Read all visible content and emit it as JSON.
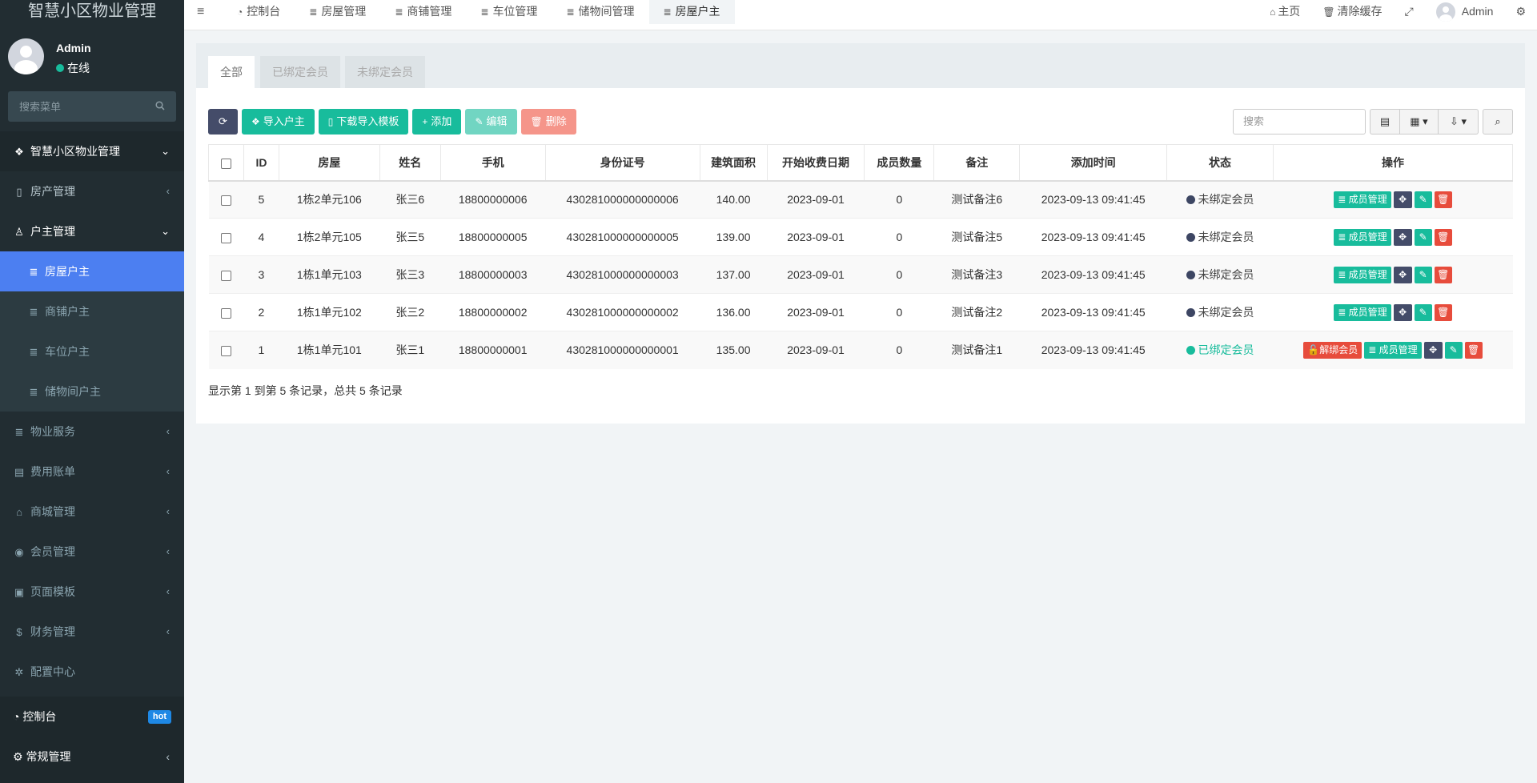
{
  "app": {
    "title": "智慧小区物业管理"
  },
  "user": {
    "name": "Admin",
    "status": "在线"
  },
  "sidebar": {
    "search_placeholder": "搜索菜单",
    "top_item": {
      "label": "智慧小区物业管理",
      "icon": "cubes-icon"
    },
    "items": [
      {
        "label": "房产管理",
        "icon": "building-icon"
      },
      {
        "label": "户主管理",
        "icon": "user-icon"
      },
      {
        "label": "房屋户主",
        "icon": "list-icon"
      },
      {
        "label": "商铺户主",
        "icon": "list-icon"
      },
      {
        "label": "车位户主",
        "icon": "list-icon"
      },
      {
        "label": "储物间户主",
        "icon": "list-icon"
      },
      {
        "label": "物业服务",
        "icon": "list-icon"
      },
      {
        "label": "费用账单",
        "icon": "bill-icon"
      },
      {
        "label": "商城管理",
        "icon": "basket-icon"
      },
      {
        "label": "会员管理",
        "icon": "user-circle-icon"
      },
      {
        "label": "页面模板",
        "icon": "image-icon"
      },
      {
        "label": "财务管理",
        "icon": "dollar-icon"
      },
      {
        "label": "配置中心",
        "icon": "gear-icon"
      }
    ],
    "bottom": {
      "dashboard": "控制台",
      "hot_badge": "hot",
      "general": "常规管理"
    }
  },
  "navbar": {
    "tabs": [
      "控制台",
      "房屋管理",
      "商铺管理",
      "车位管理",
      "储物间管理",
      "房屋户主"
    ],
    "home": "主页",
    "clear_cache": "清除缓存",
    "user": "Admin"
  },
  "panel": {
    "tabs": [
      "全部",
      "已绑定会员",
      "未绑定会员"
    ],
    "toolbar": {
      "import": "导入户主",
      "download_template": "下载导入模板",
      "add": "添加",
      "edit": "编辑",
      "delete": "删除"
    },
    "search_placeholder": "搜索",
    "columns": [
      "ID",
      "房屋",
      "姓名",
      "手机",
      "身份证号",
      "建筑面积",
      "开始收费日期",
      "成员数量",
      "备注",
      "添加时间",
      "状态",
      "操作"
    ],
    "rows": [
      {
        "id": "5",
        "house": "1栋2单元106",
        "name": "张三6",
        "phone": "18800000006",
        "idcard": "430281000000000006",
        "area": "140.00",
        "start": "2023-09-01",
        "members": "0",
        "note": "测试备注6",
        "added": "2023-09-13 09:41:45",
        "status": "未绑定会员",
        "bound": false
      },
      {
        "id": "4",
        "house": "1栋2单元105",
        "name": "张三5",
        "phone": "18800000005",
        "idcard": "430281000000000005",
        "area": "139.00",
        "start": "2023-09-01",
        "members": "0",
        "note": "测试备注5",
        "added": "2023-09-13 09:41:45",
        "status": "未绑定会员",
        "bound": false
      },
      {
        "id": "3",
        "house": "1栋1单元103",
        "name": "张三3",
        "phone": "18800000003",
        "idcard": "430281000000000003",
        "area": "137.00",
        "start": "2023-09-01",
        "members": "0",
        "note": "测试备注3",
        "added": "2023-09-13 09:41:45",
        "status": "未绑定会员",
        "bound": false
      },
      {
        "id": "2",
        "house": "1栋1单元102",
        "name": "张三2",
        "phone": "18800000002",
        "idcard": "430281000000000002",
        "area": "136.00",
        "start": "2023-09-01",
        "members": "0",
        "note": "测试备注2",
        "added": "2023-09-13 09:41:45",
        "status": "未绑定会员",
        "bound": false
      },
      {
        "id": "1",
        "house": "1栋1单元101",
        "name": "张三1",
        "phone": "18800000001",
        "idcard": "430281000000000001",
        "area": "135.00",
        "start": "2023-09-01",
        "members": "0",
        "note": "测试备注1",
        "added": "2023-09-13 09:41:45",
        "status": "已绑定会员",
        "bound": true
      }
    ],
    "actions": {
      "unbind": "解绑会员",
      "members": "成员管理"
    },
    "summary": "显示第 1 到第 5 条记录，总共 5 条记录"
  },
  "colors": {
    "sidebar_bg": "#222d32",
    "active_menu": "#4c7ff1",
    "success": "#18bc9c",
    "danger": "#e74c3c",
    "dark_button": "#444c69"
  }
}
